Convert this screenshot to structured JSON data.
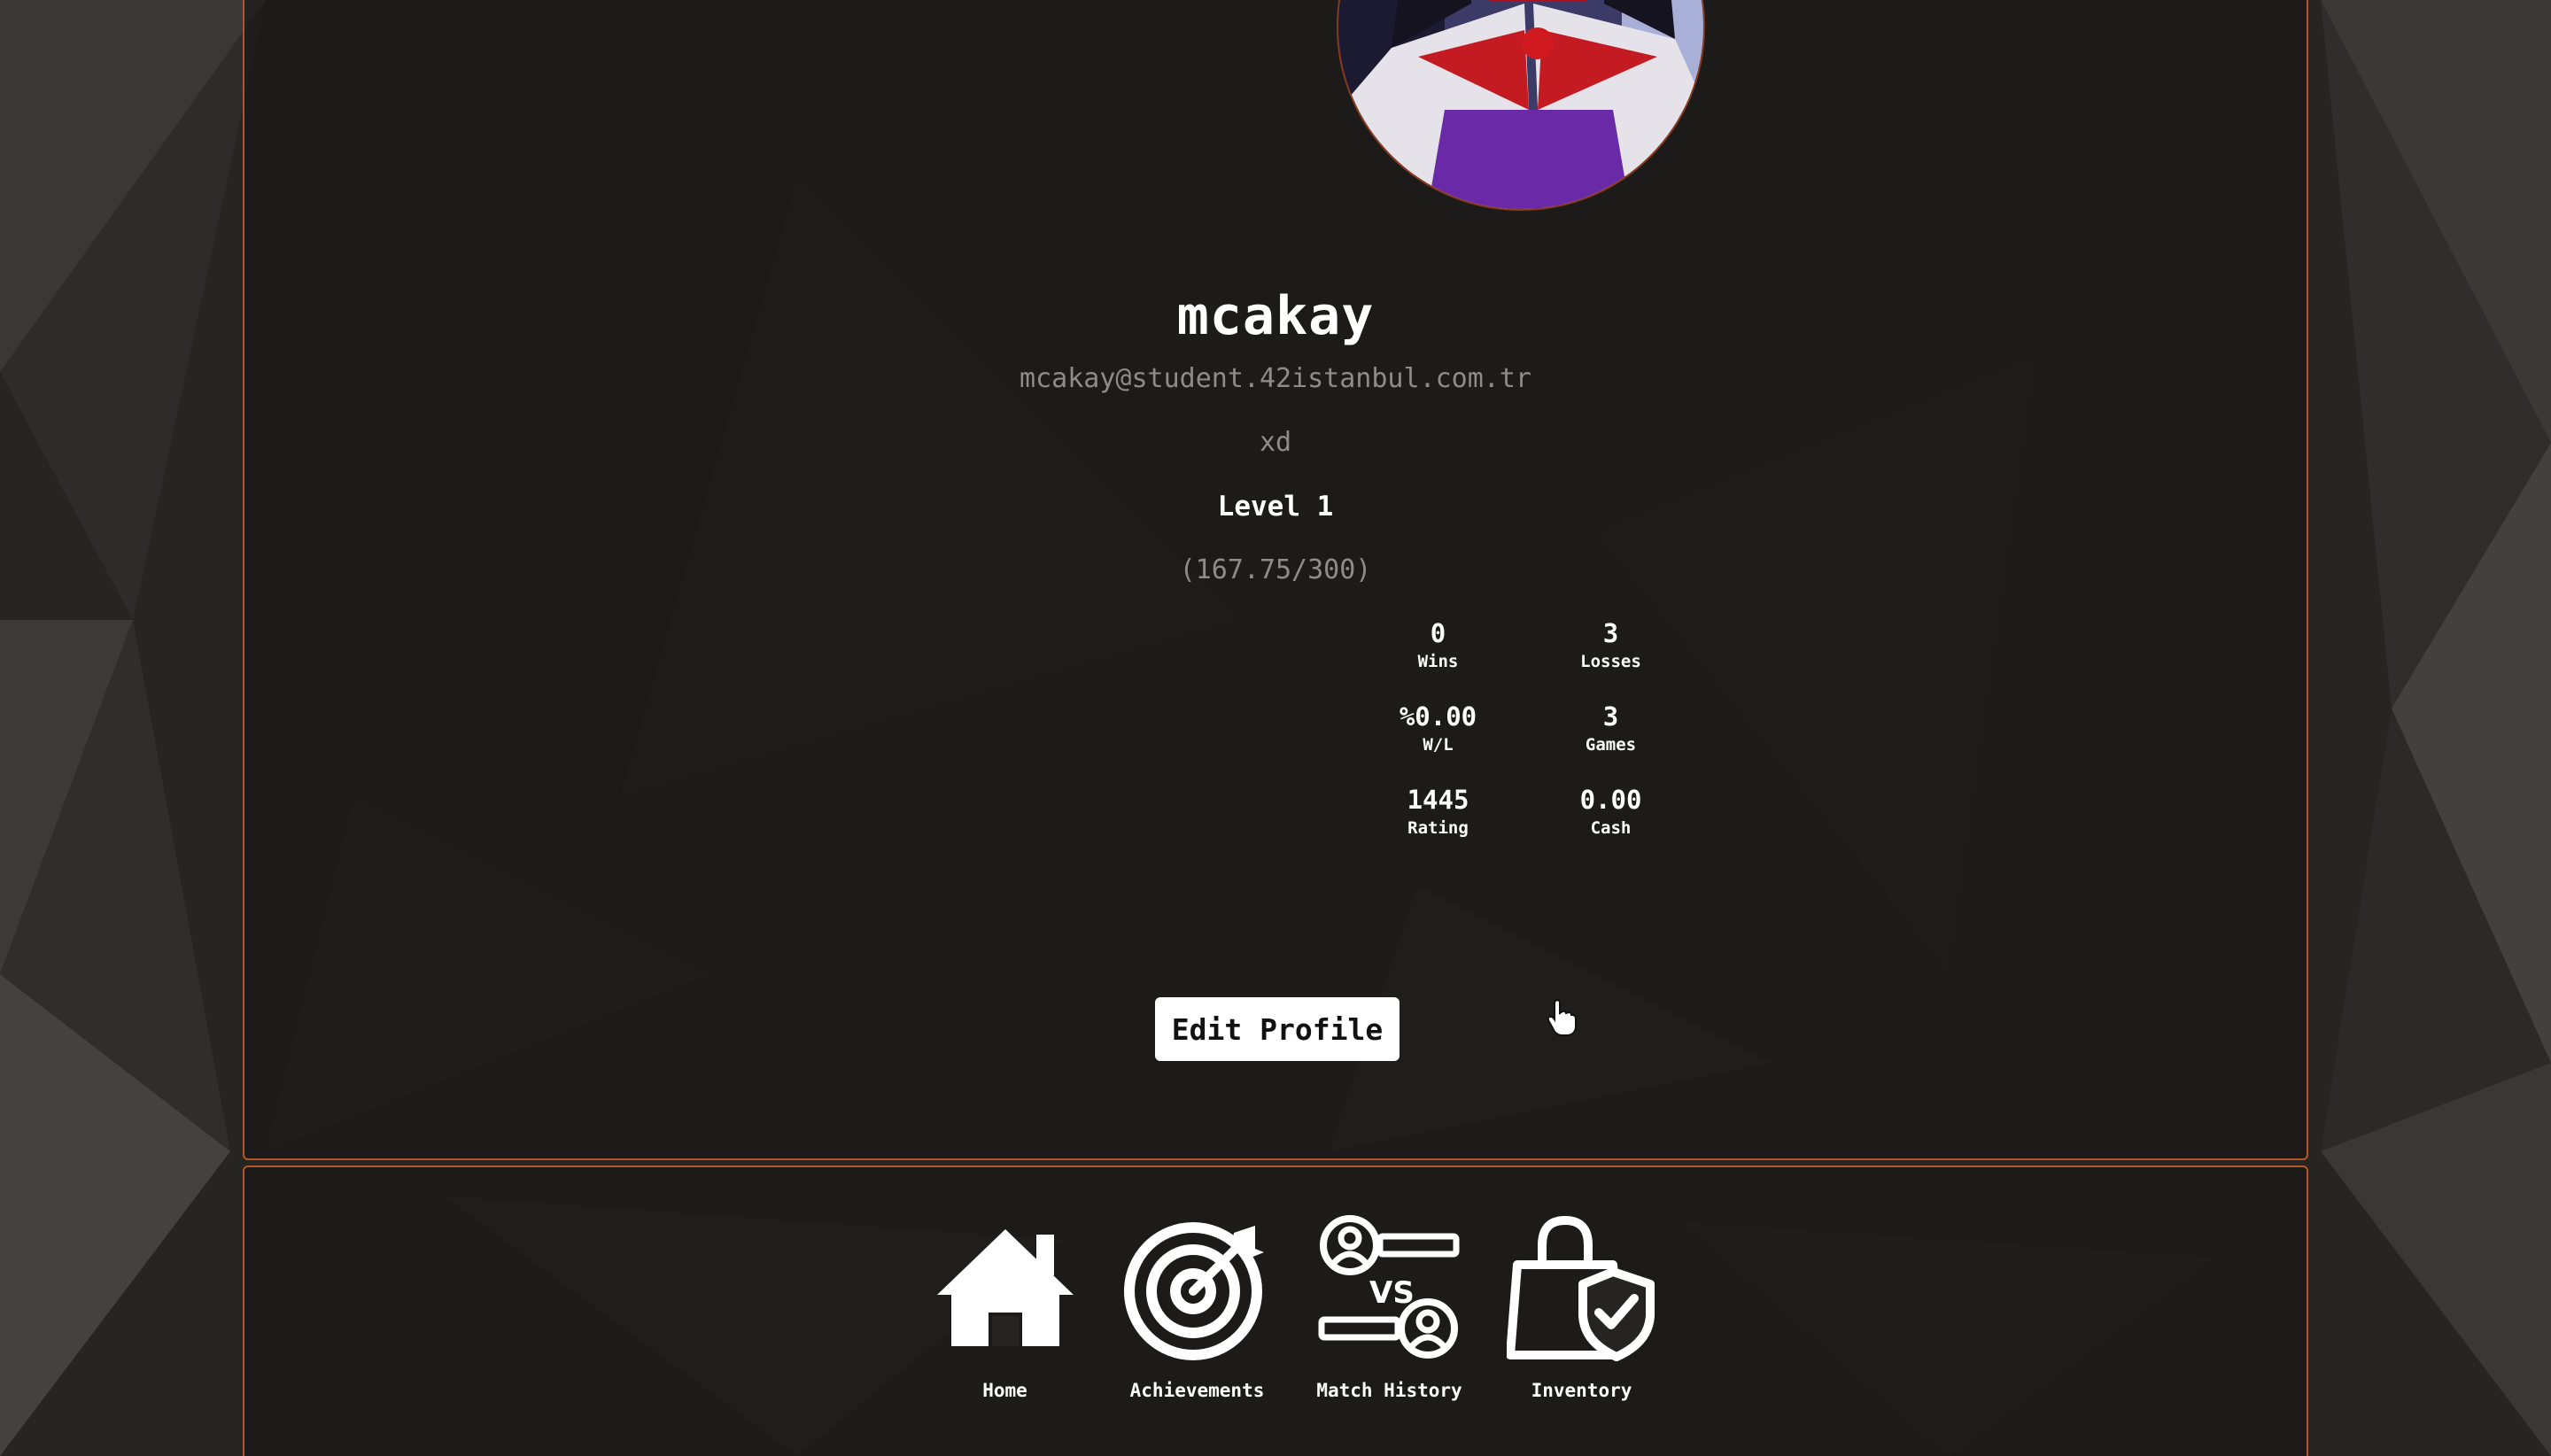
{
  "profile": {
    "username": "mcakay",
    "email": "mcakay@student.42istanbul.com.tr",
    "bio": "xd",
    "level": "Level 1",
    "xp": "(167.75/300)",
    "stats": [
      {
        "value": "0",
        "label": "Wins"
      },
      {
        "value": "3",
        "label": "Losses"
      },
      {
        "value": "%0.00",
        "label": "W/L"
      },
      {
        "value": "3",
        "label": "Games"
      },
      {
        "value": "1445",
        "label": "Rating"
      },
      {
        "value": "0.00",
        "label": "Cash"
      }
    ],
    "edit_button": "Edit Profile"
  },
  "nav": {
    "items": [
      {
        "label": "Home",
        "icon": "home-icon"
      },
      {
        "label": "Achievements",
        "icon": "target-icon"
      },
      {
        "label": "Match History",
        "icon": "versus-icon"
      },
      {
        "label": "Inventory",
        "icon": "shopping-bag-icon"
      }
    ]
  },
  "colors": {
    "accent_border": "#b5532a",
    "background": "#262422",
    "muted_text": "#8c8c8c"
  }
}
